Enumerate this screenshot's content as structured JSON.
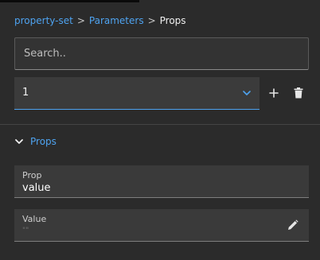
{
  "breadcrumb": {
    "items": [
      "property-set",
      "Parameters"
    ],
    "separator": ">",
    "current": "Props"
  },
  "search": {
    "placeholder": "Search..",
    "value": ""
  },
  "selector": {
    "selected": "1"
  },
  "section": {
    "title": "Props",
    "expanded": true
  },
  "fields": {
    "prop": {
      "label": "Prop",
      "value": "value"
    },
    "value": {
      "label": "Value",
      "value": "",
      "empty_hint": "\"\""
    }
  },
  "icons": {
    "select_chevron": "chevron-down-icon",
    "add": "plus-icon",
    "delete": "trash-icon",
    "section_toggle": "chevron-down-icon",
    "edit": "pencil-icon"
  },
  "colors": {
    "background": "#2b2b2b",
    "accent": "#4ea3f0",
    "field_bg": "#3a3a3a",
    "text": "#f0f0f0"
  }
}
